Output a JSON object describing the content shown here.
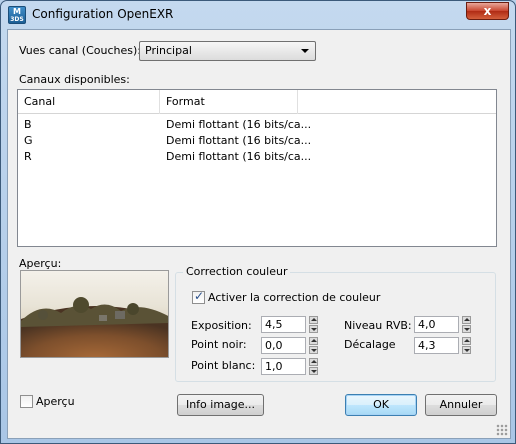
{
  "window": {
    "title": "Configuration OpenEXR",
    "icon_text_top": "M",
    "icon_text_bottom": "3DS",
    "close_label": "x"
  },
  "channel_view": {
    "label": "Vues canal (Couches):",
    "selected": "Principal"
  },
  "available": {
    "label": "Canaux disponibles:",
    "columns": [
      "Canal",
      "Format"
    ],
    "rows": [
      {
        "canal": "B",
        "format": "Demi flottant (16 bits/ca..."
      },
      {
        "canal": "G",
        "format": "Demi flottant (16 bits/ca..."
      },
      {
        "canal": "R",
        "format": "Demi flottant (16 bits/ca..."
      }
    ]
  },
  "preview": {
    "label": "Aperçu:",
    "checkbox_label": "Aperçu",
    "checked": false
  },
  "color_correction": {
    "group_title": "Correction couleur",
    "enable_label": "Activer la correction de couleur",
    "enabled": true,
    "exposure_label": "Exposition:",
    "exposure_value": "4,5",
    "black_label": "Point noir:",
    "black_value": "0,0",
    "white_label": "Point blanc:",
    "white_value": "1,0",
    "rgb_level_label": "Niveau RVB:",
    "rgb_level_value": "4,0",
    "offset_label": "Décalage",
    "offset_value": "4,3"
  },
  "buttons": {
    "info": "Info image...",
    "ok": "OK",
    "cancel": "Annuler"
  },
  "colors": {
    "accent": "#3c7fb1",
    "title_bar": "#b9d1ea",
    "close": "#c8452e"
  }
}
